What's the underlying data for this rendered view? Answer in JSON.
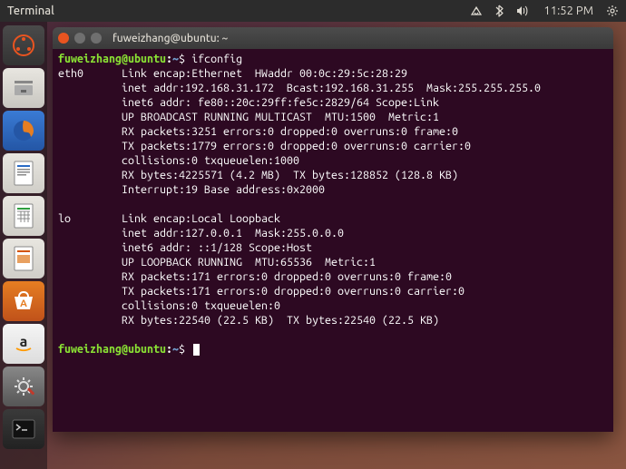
{
  "topbar": {
    "app_label": "Terminal",
    "time": "11:52 PM"
  },
  "launcher_items": [
    {
      "name": "dash",
      "tip": "Dash"
    },
    {
      "name": "files",
      "tip": "Files"
    },
    {
      "name": "firefox",
      "tip": "Firefox"
    },
    {
      "name": "writer",
      "tip": "LibreOffice Writer"
    },
    {
      "name": "calc",
      "tip": "LibreOffice Calc"
    },
    {
      "name": "impress",
      "tip": "LibreOffice Impress"
    },
    {
      "name": "software",
      "tip": "Ubuntu Software"
    },
    {
      "name": "amazon",
      "tip": "Amazon"
    },
    {
      "name": "settings",
      "tip": "System Settings"
    },
    {
      "name": "terminal",
      "tip": "Terminal"
    }
  ],
  "window": {
    "title": "fuweizhang@ubuntu: ~"
  },
  "prompt": {
    "userhost": "fuweizhang@ubuntu",
    "sep": ":",
    "path": "~",
    "dollar": "$",
    "command": "ifconfig"
  },
  "ifconfig": {
    "eth0": {
      "iface": "eth0",
      "l1": "Link encap:Ethernet  HWaddr 00:0c:29:5c:28:29",
      "l2": "inet addr:192.168.31.172  Bcast:192.168.31.255  Mask:255.255.255.0",
      "l3": "inet6 addr: fe80::20c:29ff:fe5c:2829/64 Scope:Link",
      "l4": "UP BROADCAST RUNNING MULTICAST  MTU:1500  Metric:1",
      "l5": "RX packets:3251 errors:0 dropped:0 overruns:0 frame:0",
      "l6": "TX packets:1779 errors:0 dropped:0 overruns:0 carrier:0",
      "l7": "collisions:0 txqueuelen:1000",
      "l8": "RX bytes:4225571 (4.2 MB)  TX bytes:128852 (128.8 KB)",
      "l9": "Interrupt:19 Base address:0x2000"
    },
    "lo": {
      "iface": "lo",
      "l1": "Link encap:Local Loopback",
      "l2": "inet addr:127.0.0.1  Mask:255.0.0.0",
      "l3": "inet6 addr: ::1/128 Scope:Host",
      "l4": "UP LOOPBACK RUNNING  MTU:65536  Metric:1",
      "l5": "RX packets:171 errors:0 dropped:0 overruns:0 frame:0",
      "l6": "TX packets:171 errors:0 dropped:0 overruns:0 carrier:0",
      "l7": "collisions:0 txqueuelen:0",
      "l8": "RX bytes:22540 (22.5 KB)  TX bytes:22540 (22.5 KB)"
    }
  }
}
